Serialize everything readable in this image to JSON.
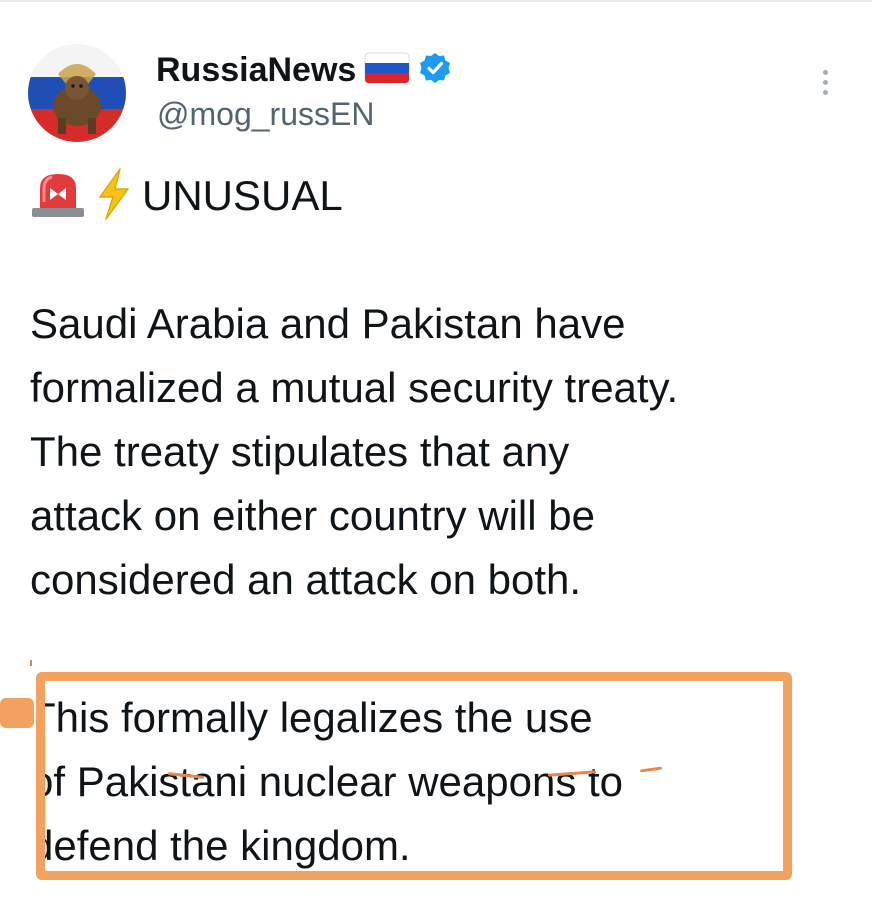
{
  "tweet": {
    "author": {
      "display_name": "RussiaNews",
      "handle": "@mog_russEN",
      "flag": "russia-flag-icon",
      "verified": true,
      "verified_color": "#1d9bf0"
    },
    "headline": {
      "icons": [
        "rotating-light-icon",
        "lightning-icon"
      ],
      "text": "UNUSUAL"
    },
    "paragraph_1": {
      "lines": [
        "Saudi Arabia and Pakistan have",
        "formalized a mutual security treaty.",
        "The treaty stipulates that any",
        "attack on either country will be",
        "considered an attack on both."
      ]
    },
    "paragraph_2": {
      "lines": [
        "This formally legalizes the use",
        "of Pakistani nuclear weapons to",
        "defend the kingdom."
      ]
    }
  },
  "annotation": {
    "highlight_color": "#f2a15e"
  }
}
